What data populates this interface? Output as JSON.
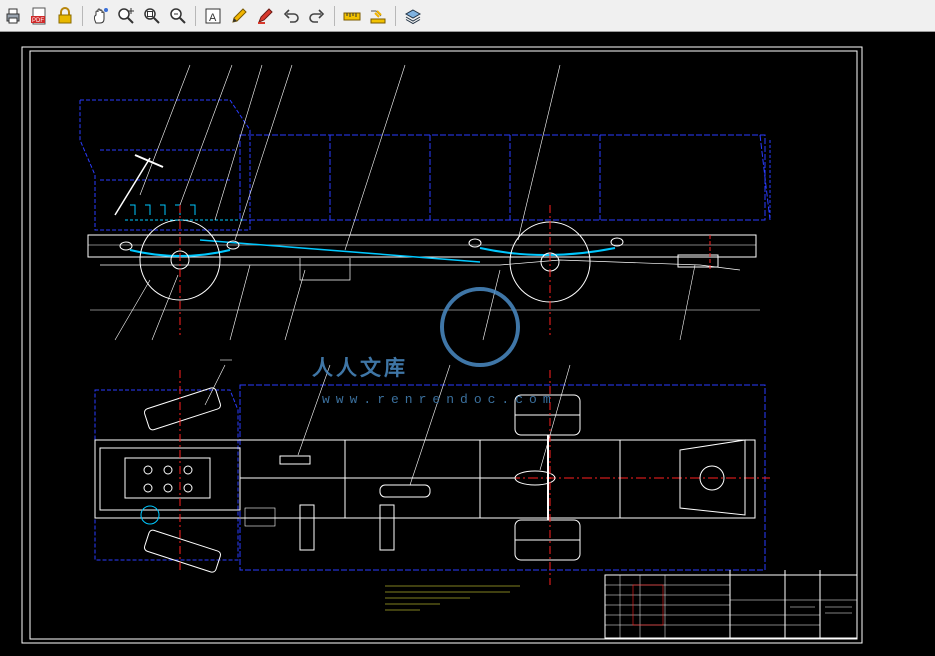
{
  "toolbar": {
    "buttons": [
      {
        "name": "print-icon"
      },
      {
        "name": "pdf-export-icon",
        "label": "PDF"
      },
      {
        "name": "lock-icon"
      },
      {
        "name": "pan-icon"
      },
      {
        "name": "zoom-in-icon"
      },
      {
        "name": "zoom-window-icon"
      },
      {
        "name": "zoom-extents-icon"
      },
      {
        "name": "text-icon",
        "label": "A"
      },
      {
        "name": "pencil-icon"
      },
      {
        "name": "markup-pen-icon"
      },
      {
        "name": "undo-icon"
      },
      {
        "name": "redo-icon"
      },
      {
        "name": "measure-icon"
      },
      {
        "name": "measure-area-icon"
      },
      {
        "name": "layers-icon"
      }
    ]
  },
  "drawing": {
    "watermark": {
      "brand": "人人文库",
      "url": "www.renrendoc.com"
    },
    "colors": {
      "frame": "#ffffff",
      "hidden": "#2a3cff",
      "center": "#ff2020",
      "part": "#00c8ff",
      "detail": "#ffff40"
    }
  }
}
